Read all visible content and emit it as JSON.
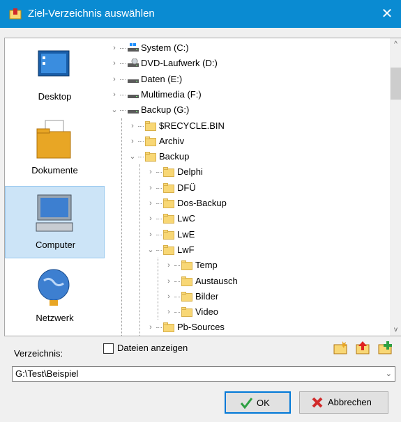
{
  "window": {
    "title": "Ziel-Verzeichnis auswählen",
    "close_label": "✕"
  },
  "places": [
    {
      "label": "Desktop"
    },
    {
      "label": "Dokumente"
    },
    {
      "label": "Computer",
      "selected": true
    },
    {
      "label": "Netzwerk"
    }
  ],
  "tree": [
    {
      "label": "System (C:)",
      "depth": 0,
      "kind": "drive-win",
      "expander": "›"
    },
    {
      "label": "DVD-Laufwerk (D:)",
      "depth": 0,
      "kind": "drive-dvd",
      "expander": "›"
    },
    {
      "label": "Daten (E:)",
      "depth": 0,
      "kind": "drive",
      "expander": "›"
    },
    {
      "label": "Multimedia (F:)",
      "depth": 0,
      "kind": "drive",
      "expander": "›"
    },
    {
      "label": "Backup (G:)",
      "depth": 0,
      "kind": "drive",
      "expander": "⌄"
    },
    {
      "label": "$RECYCLE.BIN",
      "depth": 1,
      "kind": "folder",
      "expander": "›"
    },
    {
      "label": "Archiv",
      "depth": 1,
      "kind": "folder",
      "expander": "›"
    },
    {
      "label": "Backup",
      "depth": 1,
      "kind": "folder",
      "expander": "⌄"
    },
    {
      "label": "Delphi",
      "depth": 2,
      "kind": "folder",
      "expander": "›"
    },
    {
      "label": "DFÜ",
      "depth": 2,
      "kind": "folder",
      "expander": "›"
    },
    {
      "label": "Dos-Backup",
      "depth": 2,
      "kind": "folder",
      "expander": "›"
    },
    {
      "label": "LwC",
      "depth": 2,
      "kind": "folder",
      "expander": "›"
    },
    {
      "label": "LwE",
      "depth": 2,
      "kind": "folder",
      "expander": "›"
    },
    {
      "label": "LwF",
      "depth": 2,
      "kind": "folder",
      "expander": "⌄"
    },
    {
      "label": "Temp",
      "depth": 3,
      "kind": "folder",
      "expander": "›"
    },
    {
      "label": "Austausch",
      "depth": 3,
      "kind": "folder",
      "expander": "›"
    },
    {
      "label": "Bilder",
      "depth": 3,
      "kind": "folder",
      "expander": "›"
    },
    {
      "label": "Video",
      "depth": 3,
      "kind": "folder",
      "expander": "›"
    },
    {
      "label": "Pb-Sources",
      "depth": 2,
      "kind": "folder",
      "expander": "›"
    }
  ],
  "scrollbar": {
    "up": "^",
    "down": "v"
  },
  "options": {
    "show_files_label": "Dateien anzeigen",
    "show_files_checked": false
  },
  "path": {
    "label": "Verzeichnis:",
    "value": "G:\\Test\\Beispiel",
    "dropdown": "⌄"
  },
  "buttons": {
    "ok_label": "OK",
    "cancel_label": "Abbrechen"
  },
  "colors": {
    "titlebar": "#0a8bd2",
    "selection": "#cce4f7",
    "folder": "#f8d775",
    "accent": "#0078d7"
  }
}
